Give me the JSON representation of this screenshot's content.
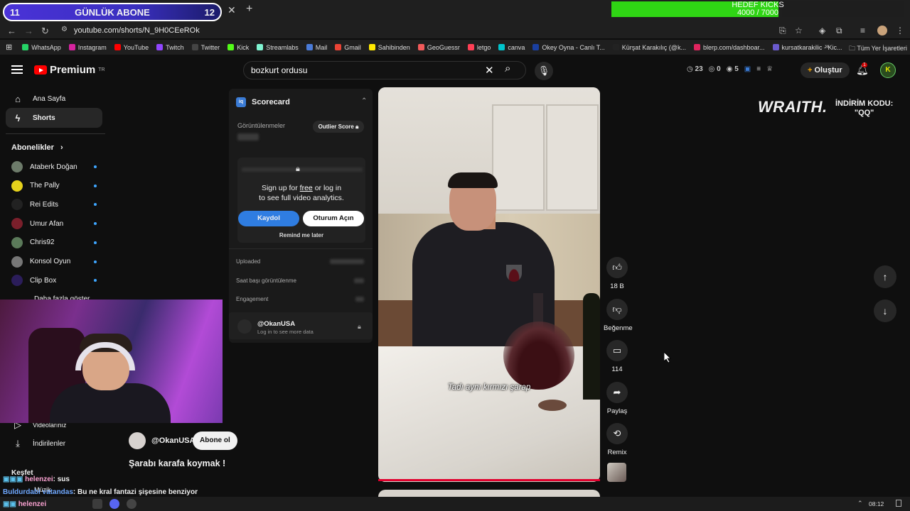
{
  "overlay": {
    "left_count": "11",
    "title": "GÜNLÜK ABONE",
    "right_count": "12",
    "goal_title": "HEDEF KICKS",
    "goal_value": "4000 / 7000",
    "goal_fraction": 0.571
  },
  "browser": {
    "tab_partial": "kce",
    "url": "youtube.com/shorts/N_9H0CEeROk",
    "bookmarks": [
      {
        "label": "WhatsApp",
        "color": "#25d366"
      },
      {
        "label": "Instagram",
        "color": "#d6249f"
      },
      {
        "label": "YouTube",
        "color": "#ff0000"
      },
      {
        "label": "Twitch",
        "color": "#9146ff"
      },
      {
        "label": "Twitter",
        "color": "#444444"
      },
      {
        "label": "Kick",
        "color": "#53fc18"
      },
      {
        "label": "Streamlabs",
        "color": "#80f5d2"
      },
      {
        "label": "Mail",
        "color": "#4a7bd8"
      },
      {
        "label": "Gmail",
        "color": "#ea4335"
      },
      {
        "label": "Sahibinden",
        "color": "#ffe800"
      },
      {
        "label": "GeoGuessr",
        "color": "#f25a5a"
      },
      {
        "label": "letgo",
        "color": "#ff3f55"
      },
      {
        "label": "canva",
        "color": "#00c4cc"
      },
      {
        "label": "Okey Oyna - Canlı T...",
        "color": "#1a3fa0"
      },
      {
        "label": "Kürşat Karakılıç (@k...",
        "color": "#222222"
      },
      {
        "label": "blerp.com/dashboar...",
        "color": "#e0245e"
      },
      {
        "label": "kursatkarakilic - Kic...",
        "color": "#6a5acd"
      }
    ],
    "all_bookmarks": "Tüm Yer İşaretleri"
  },
  "header": {
    "logo_text": "Premium",
    "logo_region": "TR",
    "search_value": "bozkurt ordusu",
    "stats": [
      "23",
      "0",
      "5"
    ],
    "create_label": "Oluştur",
    "notif_count": "1",
    "avatar_letter": "K"
  },
  "sidebar": {
    "items": [
      {
        "label": "Ana Sayfa",
        "icon": "home-icon"
      },
      {
        "label": "Shorts",
        "icon": "shorts-icon"
      }
    ],
    "subs_heading": "Abonelikler",
    "subscriptions": [
      {
        "label": "Ataberk Doğan",
        "color": "#6d7b6a"
      },
      {
        "label": "The Pally",
        "color": "#e6d21c"
      },
      {
        "label": "Rei Edits",
        "color": "#222222"
      },
      {
        "label": "Umur Afan",
        "color": "#7a1f2b"
      },
      {
        "label": "Chris92",
        "color": "#5b7a5a"
      },
      {
        "label": "Konsol Oyun",
        "color": "#777777"
      },
      {
        "label": "Clip Box",
        "color": "#2b1d5a"
      }
    ],
    "show_more": "Daha fazla göster",
    "videos_label": "Videolarınız",
    "downloads_label": "İndirilenler",
    "explore_label": "Keşfet",
    "music_label": "Müzik"
  },
  "scorecard": {
    "title": "Scorecard",
    "views_label": "Görüntülenmeler",
    "outlier_label": "Outlier Score",
    "signup_line1_a": "Sign up for",
    "signup_free": "free",
    "signup_line1_b": "or log in",
    "signup_line2": "to see full video analytics.",
    "register_label": "Kaydol",
    "login_label": "Oturum Açın",
    "remind_label": "Remind me later",
    "uploaded_label": "Uploaded",
    "hourly_label": "Saat başı görüntülenme",
    "engagement_label": "Engagement",
    "user_handle": "@OkanUSA",
    "user_sub": "Log in to see more data"
  },
  "video": {
    "caption": "Tadı aynı kırmızı şarap",
    "channel": "@OkanUSA",
    "subscribe_label": "Abone ol",
    "title": "Şarabı karafa koymak !",
    "progress": 1.0
  },
  "actions": {
    "likes": "18 B",
    "dislike_label": "Beğenme",
    "comments": "114",
    "share_label": "Paylaş",
    "remix_label": "Remix"
  },
  "sponsor": {
    "brand": "WRAITH.",
    "code_label": "İNDİRİM KODU:",
    "code": "\"QQ\""
  },
  "chat": [
    {
      "name": "helenzei",
      "text": ": sus"
    },
    {
      "name": "Buldurdabi vatandas",
      "text": ": Bu ne kral fantazi şişesine benziyor"
    },
    {
      "name": "helenzei",
      "text": "Deveet"
    }
  ],
  "taskbar": {
    "time": "08:12"
  }
}
